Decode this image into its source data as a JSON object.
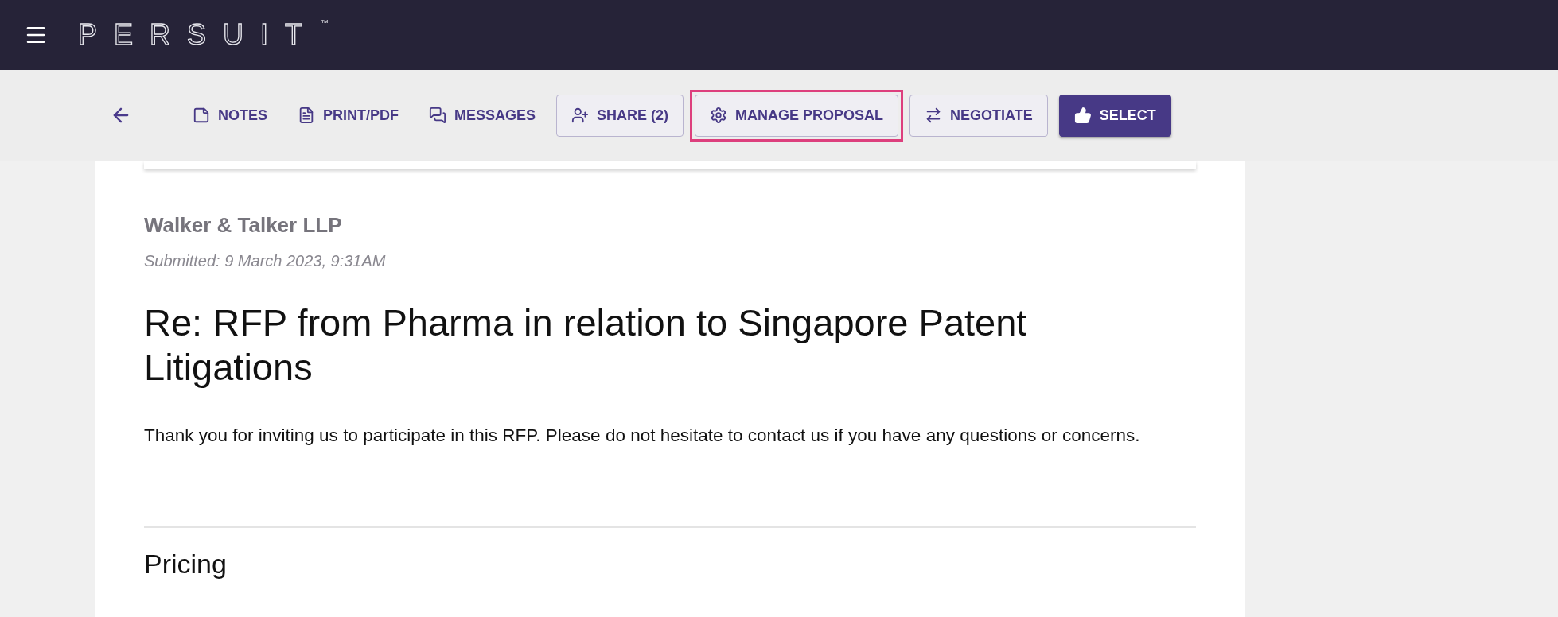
{
  "header": {
    "logo": "PERSUIT",
    "trademark": "™"
  },
  "toolbar": {
    "actions": [
      {
        "kind": "link",
        "label": "NOTES",
        "highlighted": false
      },
      {
        "kind": "link",
        "label": "PRINT/PDF",
        "highlighted": false
      },
      {
        "kind": "link",
        "label": "MESSAGES",
        "highlighted": false
      },
      {
        "kind": "outlined",
        "label": "SHARE (2)",
        "highlighted": false
      },
      {
        "kind": "outlined",
        "label": "MANAGE PROPOSAL",
        "highlighted": true
      },
      {
        "kind": "outlined",
        "label": "NEGOTIATE",
        "highlighted": false
      },
      {
        "kind": "primary",
        "label": "SELECT",
        "highlighted": false
      }
    ]
  },
  "proposal": {
    "firm": "Walker & Talker LLP",
    "submitted": "Submitted: 9 March 2023, 9:31AM",
    "title": "Re: RFP from Pharma in relation to Singapore Patent Litigations",
    "message": "Thank you for inviting us to participate in this RFP. Please do not hesitate to contact us if you have any questions or concerns.",
    "section": "Pricing"
  }
}
